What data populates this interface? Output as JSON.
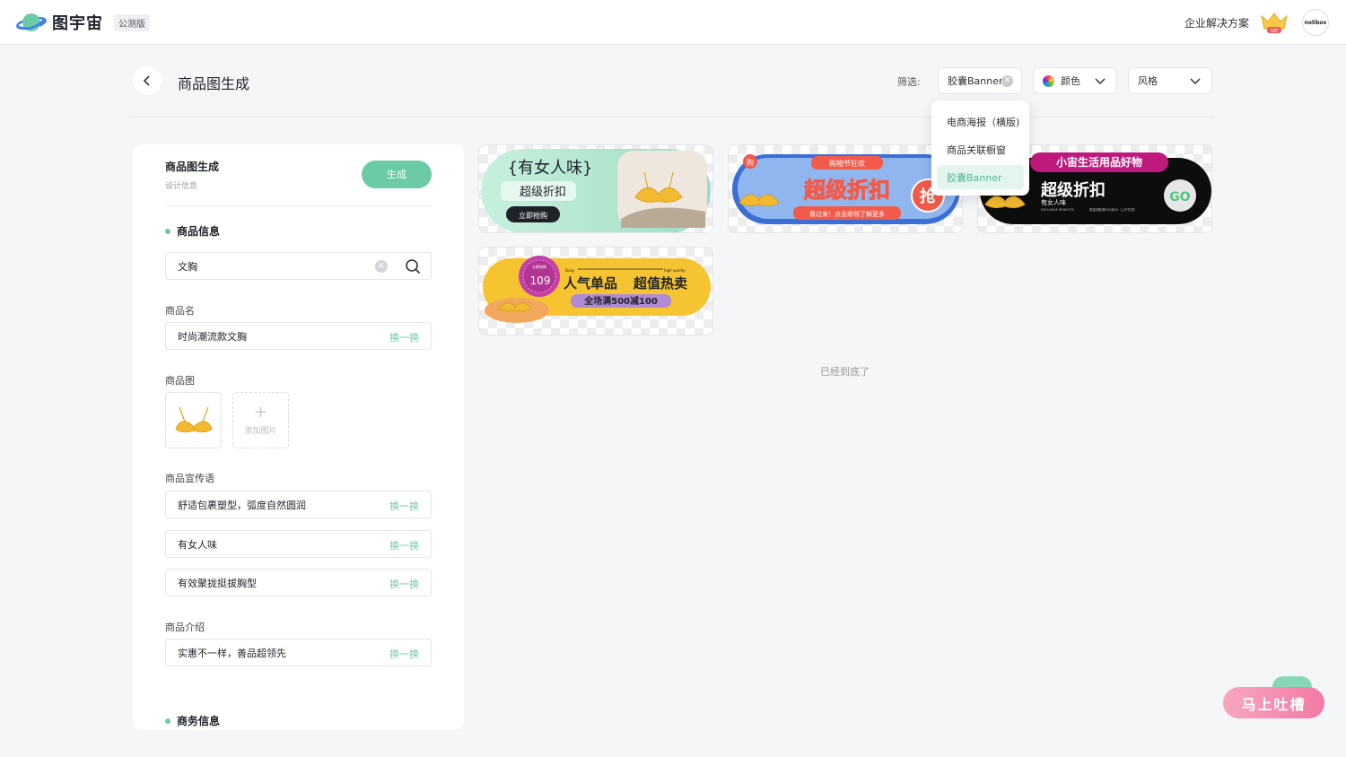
{
  "app": {
    "name": "图宇宙",
    "beta_tag": "公测版",
    "enterprise_link": "企业解决方案",
    "vip_label": "VIP",
    "avatar_text": "nolibox"
  },
  "header": {
    "title": "商品图生成",
    "filter_label": "筛选:",
    "filter_chip": "胶囊Banner",
    "color_select": "颜色",
    "style_select": "风格"
  },
  "dropdown": {
    "items": [
      "电商海报（横版)",
      "商品关联橱窗",
      "胶囊Banner"
    ],
    "selected_index": 2
  },
  "panel": {
    "title": "商品图生成",
    "subtitle": "设计信息",
    "generate_label": "生成",
    "product_section": "商品信息",
    "search_value": "文胸",
    "name_label": "商品名",
    "name_value": "时尚潮流款文胸",
    "swap_label": "换一换",
    "image_label": "商品图",
    "add_image_label": "添加图片",
    "slogan_label": "商品宣传语",
    "slogans": [
      "舒适包裹塑型，弧度自然圆润",
      "有女人味",
      "有效聚拢挺拔胸型"
    ],
    "intro_label": "商品介绍",
    "intro_value": "实惠不一样，善品超领先",
    "business_section": "商务信息"
  },
  "cards": [
    {
      "headline": "{有女人味}",
      "sub": "超级折扣",
      "cta": "立即抢购"
    },
    {
      "tag": "购物节狂欢",
      "headline": "超级折扣",
      "sub": "看过来！点击即领了解更多",
      "badge": "抢",
      "corner": "购"
    },
    {
      "tag": "小宙生活用品好物",
      "headline": "超级折扣",
      "sub": "有女人味",
      "small_left": "EXCLUSIVE BENEFITS",
      "small_right": "限量领取满500减30（上不封顶）",
      "cta": "GO"
    },
    {
      "stamp_top": "立即抢购",
      "price": "109",
      "left_small": "Daily",
      "right_small": "high quality",
      "headline_a": "人气单品",
      "headline_b": "超值热卖",
      "sub": "全场满500减100"
    }
  ],
  "end_text": "已经到底了",
  "feedback_label": "马上吐槽",
  "colors": {
    "accent": "#6ccba7",
    "feedback": "#f27aa3"
  }
}
